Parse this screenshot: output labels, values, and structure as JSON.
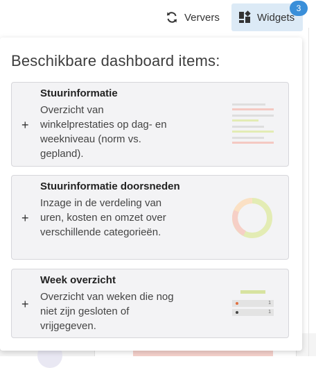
{
  "toolbar": {
    "refresh_label": "Ververs",
    "widgets_label": "Widgets",
    "widgets_badge": "3",
    "refresh_icon": "refresh-icon",
    "widgets_icon": "widgets-icon"
  },
  "popover": {
    "title": "Beschikbare dashboard items:",
    "items": [
      {
        "title": "Stuurinformatie",
        "description": "Overzicht van winkelprestaties op dag- en weekniveau (norm vs. gepland).",
        "icon": "plus-icon"
      },
      {
        "title": "Stuurinformatie doorsneden",
        "description": "Inzage in de verdeling van uren, kosten en omzet over verschillende categorieën.",
        "icon": "plus-icon"
      },
      {
        "title": "Week overzicht",
        "description": "Overzicht van weken die nog niet zijn gesloten of vrijgegeven.",
        "icon": "plus-icon",
        "preview_rows": [
          "1",
          "1"
        ]
      }
    ]
  },
  "colors": {
    "accent": "#3a8fd9",
    "widgets_bg": "#dceaf6",
    "card_bg": "#f3f3f5"
  }
}
